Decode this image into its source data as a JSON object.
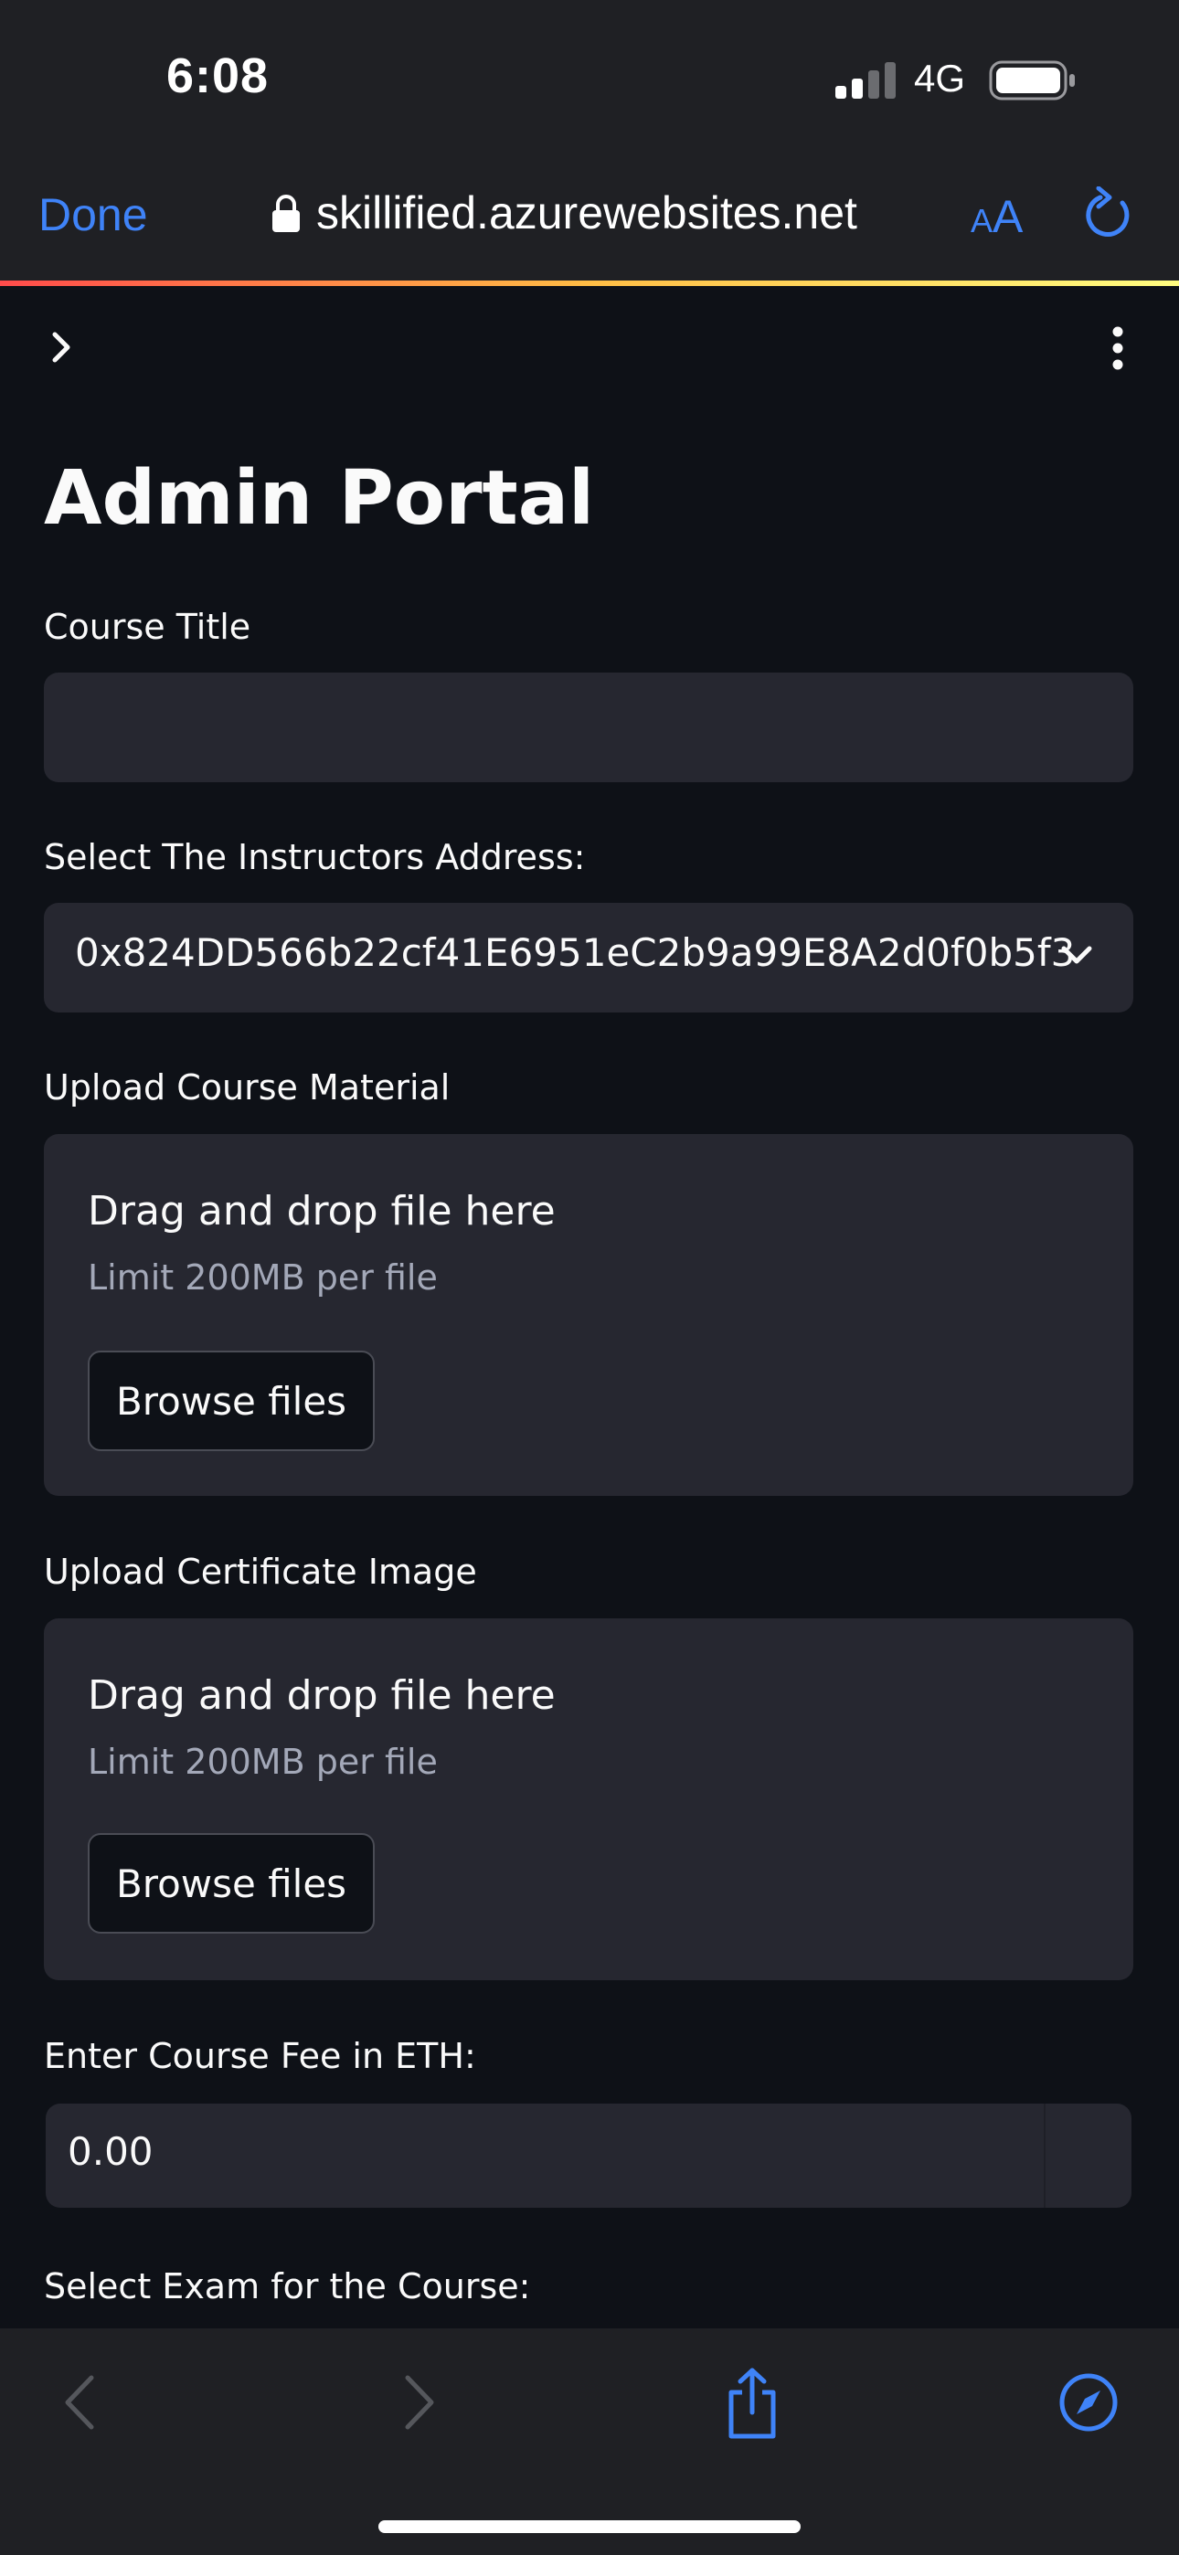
{
  "status": {
    "time": "6:08",
    "network": "4G"
  },
  "browser": {
    "done_label": "Done",
    "url": "skillified.azurewebsites.net",
    "text_size_small": "A",
    "text_size_big": "A"
  },
  "page": {
    "title": "Admin Portal",
    "course_title": {
      "label": "Course Title",
      "value": ""
    },
    "instructor": {
      "label": "Select The Instructors Address:",
      "selected": "0x824DD566b22cf41E6951eC2b9a99E8A2d0f0b5f3"
    },
    "material": {
      "label": "Upload Course Material",
      "drop_text": "Drag and drop file here",
      "limit": "Limit 200MB per file",
      "browse": "Browse files"
    },
    "certificate": {
      "label": "Upload Certificate Image",
      "drop_text": "Drag and drop file here",
      "limit": "Limit 200MB per file",
      "browse": "Browse files"
    },
    "fee": {
      "label": "Enter Course Fee in ETH:",
      "value": "0.00"
    },
    "exam": {
      "label": "Select Exam for the Course:"
    }
  },
  "icons": {
    "sidebar_toggle": "chevron-right-icon",
    "menu": "kebab-menu-icon",
    "lock": "lock-icon",
    "reload": "reload-icon",
    "back": "back-arrow-icon",
    "forward": "forward-arrow-icon",
    "share": "share-icon",
    "compass": "compass-icon"
  },
  "colors": {
    "accent": "#3f83f8",
    "page_bg": "#0e1117",
    "field_bg": "#262730",
    "chrome_bg": "#1f2024"
  }
}
